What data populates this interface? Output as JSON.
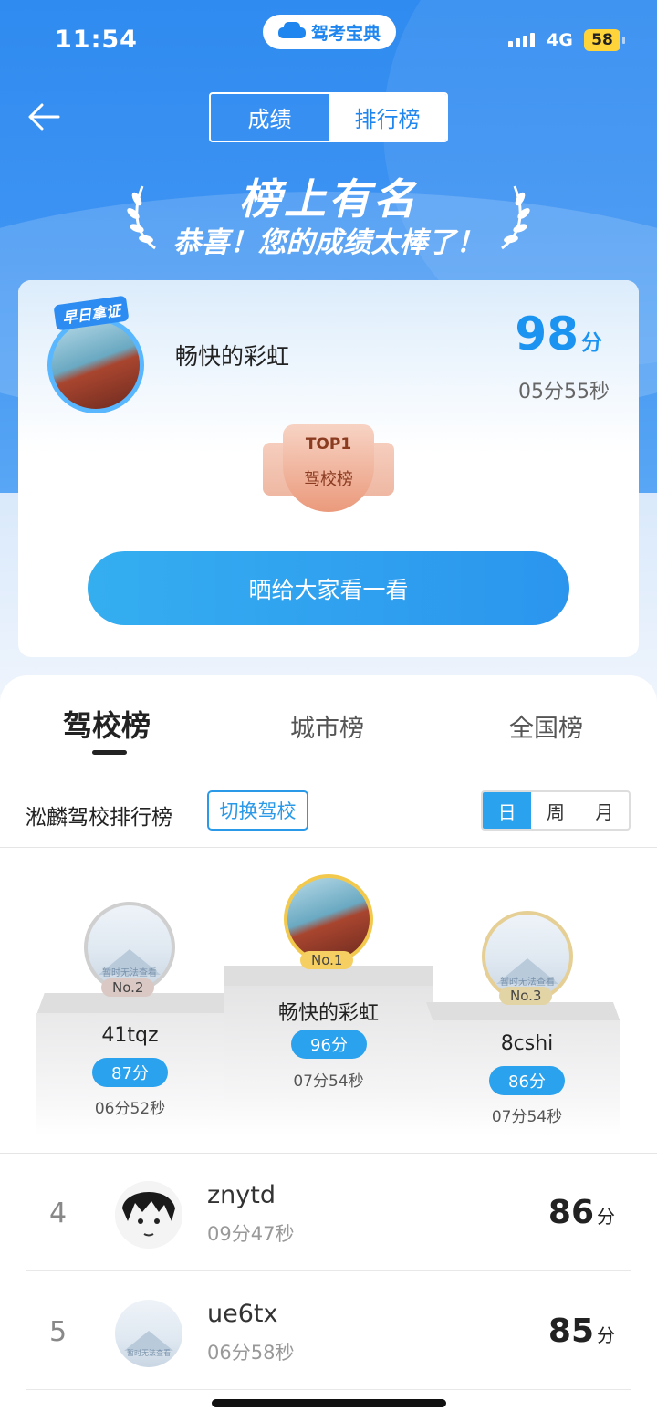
{
  "status": {
    "time": "11:54",
    "network": "4G",
    "battery": "58",
    "app_badge": "驾考宝典"
  },
  "header": {
    "tabs": [
      "成绩",
      "排行榜"
    ],
    "active_tab": 1
  },
  "banner": {
    "title": "榜上有名",
    "subtitle": "恭喜！您的成绩太棒了！"
  },
  "my_result": {
    "tag": "早日拿证",
    "name": "畅快的彩虹",
    "score": "98",
    "score_unit": "分",
    "time": "05分55秒",
    "medal_top": "TOP1",
    "medal_label": "驾校榜",
    "share_button": "晒给大家看一看"
  },
  "board_tabs": [
    "驾校榜",
    "城市榜",
    "全国榜"
  ],
  "school_bar": {
    "title": "淞麟驾校排行榜",
    "switch_label": "切换驾校",
    "periods": [
      "日",
      "周",
      "月"
    ],
    "selected_period": 0
  },
  "podium": [
    {
      "rank": "No.1",
      "name": "畅快的彩虹",
      "score": "96分",
      "time": "07分54秒"
    },
    {
      "rank": "No.2",
      "name": "41tqz",
      "score": "87分",
      "time": "06分52秒",
      "avatar_text": "暂时无法查看"
    },
    {
      "rank": "No.3",
      "name": "8cshi",
      "score": "86分",
      "time": "07分54秒",
      "avatar_text": "暂时无法查看"
    }
  ],
  "list": [
    {
      "rank": "4",
      "name": "znytd",
      "time": "09分47秒",
      "score": "86",
      "unit": "分"
    },
    {
      "rank": "5",
      "name": "ue6tx",
      "time": "06分58秒",
      "score": "85",
      "unit": "分",
      "avatar_text": "暂时无法查看"
    }
  ],
  "colors": {
    "primary": "#2a9ae8",
    "hero": "#2f8bf0",
    "score": "#1a93f1"
  }
}
